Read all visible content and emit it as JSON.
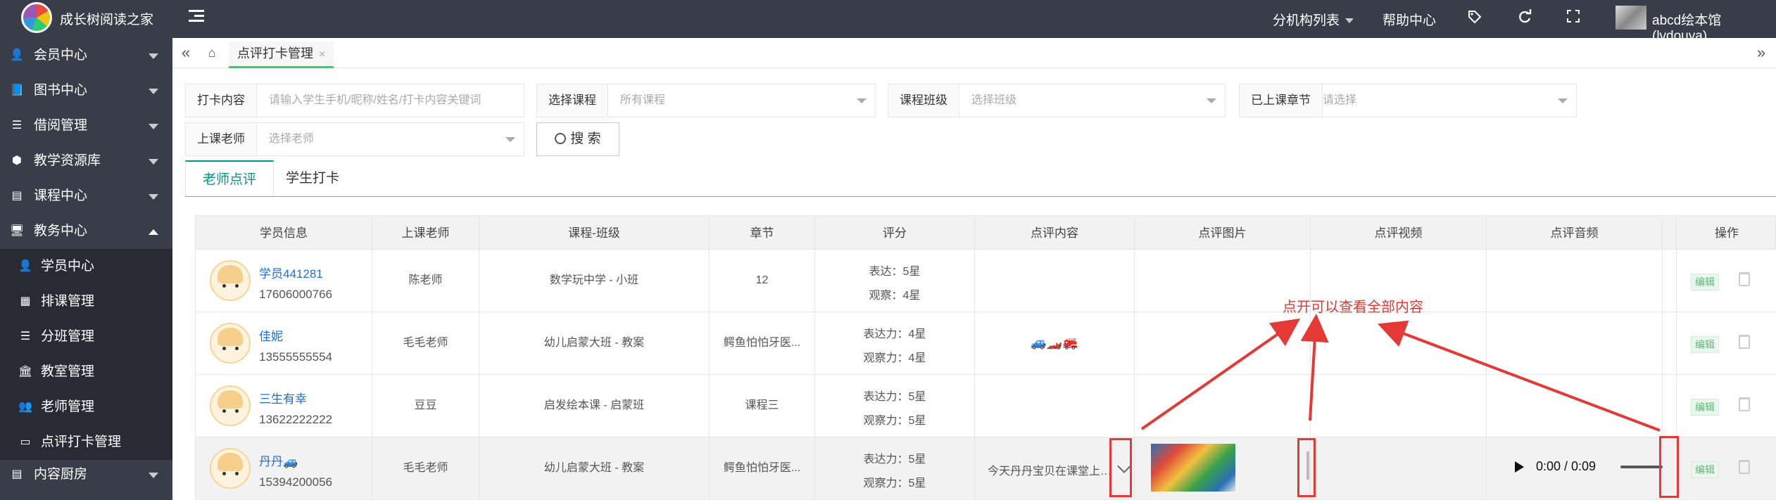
{
  "header": {
    "site_title": "成长树阅读之家",
    "branch_list": "分机构列表",
    "help_center": "帮助中心",
    "user_name": "abcd绘本馆(lvdouya)"
  },
  "sidebar": {
    "items": [
      {
        "label": "会员中心",
        "icon": "user-plus-icon"
      },
      {
        "label": "图书中心",
        "icon": "book-icon"
      },
      {
        "label": "借阅管理",
        "icon": "list-icon"
      },
      {
        "label": "教学资源库",
        "icon": "cubes-icon"
      },
      {
        "label": "课程中心",
        "icon": "file-icon"
      },
      {
        "label": "教务中心",
        "icon": "monitor-icon"
      }
    ],
    "subitems": [
      {
        "label": "学员中心",
        "icon": "user-icon"
      },
      {
        "label": "排课管理",
        "icon": "calendar-icon"
      },
      {
        "label": "分班管理",
        "icon": "list-icon"
      },
      {
        "label": "教室管理",
        "icon": "bank-icon"
      },
      {
        "label": "老师管理",
        "icon": "users-icon"
      },
      {
        "label": "点评打卡管理",
        "icon": "card-icon"
      }
    ],
    "last": {
      "label": "内容厨房",
      "icon": "file-icon"
    }
  },
  "tabs": {
    "page_tab": "点评打卡管理",
    "close": "×"
  },
  "filters": {
    "checkin_label": "打卡内容",
    "checkin_placeholder": "请输入学生手机/昵称/姓名/打卡内容关键词",
    "course_label": "选择课程",
    "course_value": "所有课程",
    "class_label": "课程班级",
    "class_value": "选择班级",
    "chapter_label": "已上课章节",
    "chapter_value": "请选择",
    "teacher_label": "上课老师",
    "teacher_value": "选择老师",
    "search_button": "搜 索"
  },
  "content_tabs": [
    "老师点评",
    "学生打卡"
  ],
  "table": {
    "columns": [
      "学员信息",
      "上课老师",
      "课程-班级",
      "章节",
      "评分",
      "点评内容",
      "点评图片",
      "点评视频",
      "点评音频",
      "操作"
    ],
    "rows": [
      {
        "name": "学员441281",
        "phone": "17606000766",
        "teacher": "陈老师",
        "course": "数学玩中学 - 小班",
        "chapter": "12",
        "score1": "表达：5星",
        "score2": "观察：4星",
        "comment": "",
        "edit": "编辑"
      },
      {
        "name": "佳妮",
        "phone": "13555555554",
        "teacher": "毛毛老师",
        "course": "幼儿启蒙大班 - 教案",
        "chapter": "鳄鱼怕怕牙医...",
        "score1": "表达力：4星",
        "score2": "观察力：4星",
        "comment": "🚙🏎️🚒",
        "edit": "编辑"
      },
      {
        "name": "三生有幸",
        "phone": "13622222222",
        "teacher": "豆豆",
        "course": "启发绘本课 - 启蒙班",
        "chapter": "课程三",
        "score1": "表达力：5星",
        "score2": "观察力：5星",
        "comment": "",
        "edit": "编辑"
      },
      {
        "name": "丹丹🚙",
        "phone": "15394200056",
        "teacher": "毛毛老师",
        "course": "幼儿启蒙大班 - 教案",
        "chapter": "鳄鱼怕怕牙医...",
        "score1": "表达力：5星",
        "score2": "观察力：5星",
        "comment": "今天丹丹宝贝在课堂上表现很棒",
        "audio_time": "0:00 / 0:09",
        "edit": "编辑"
      }
    ]
  },
  "annotation": {
    "text": "点开可以查看全部内容",
    "color": "#e53935"
  }
}
